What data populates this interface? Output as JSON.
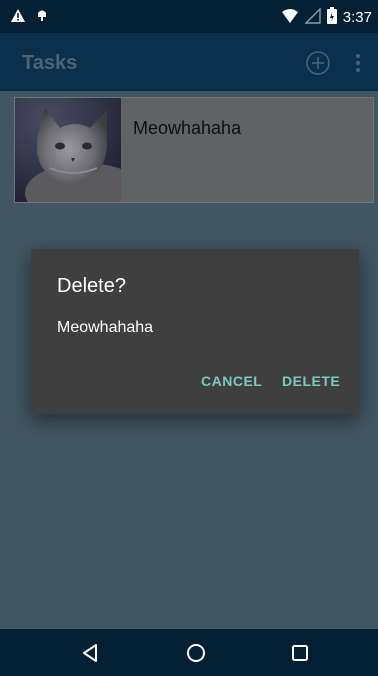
{
  "status_bar": {
    "time": "3:37",
    "icons": [
      "warning-icon",
      "android-debug-icon",
      "wifi-icon",
      "cell-signal-icon",
      "battery-icon"
    ]
  },
  "app_bar": {
    "title": "Tasks",
    "actions": [
      "add-circle-icon",
      "overflow-menu-icon"
    ]
  },
  "task_list": {
    "items": [
      {
        "title": "Meowhahaha",
        "image": "cat-photo"
      }
    ]
  },
  "dialog": {
    "title": "Delete?",
    "message": "Meowhahaha",
    "cancel_label": "CANCEL",
    "delete_label": "DELETE"
  },
  "nav_bar": {
    "buttons": [
      "back-icon",
      "home-icon",
      "recents-icon"
    ]
  },
  "colors": {
    "status_bar_bg": "#042035",
    "app_bar_bg": "#0a304e",
    "scrim_content": "#425562",
    "dialog_bg": "#3f3f3f",
    "dialog_button_accent": "#7ec9bd"
  }
}
